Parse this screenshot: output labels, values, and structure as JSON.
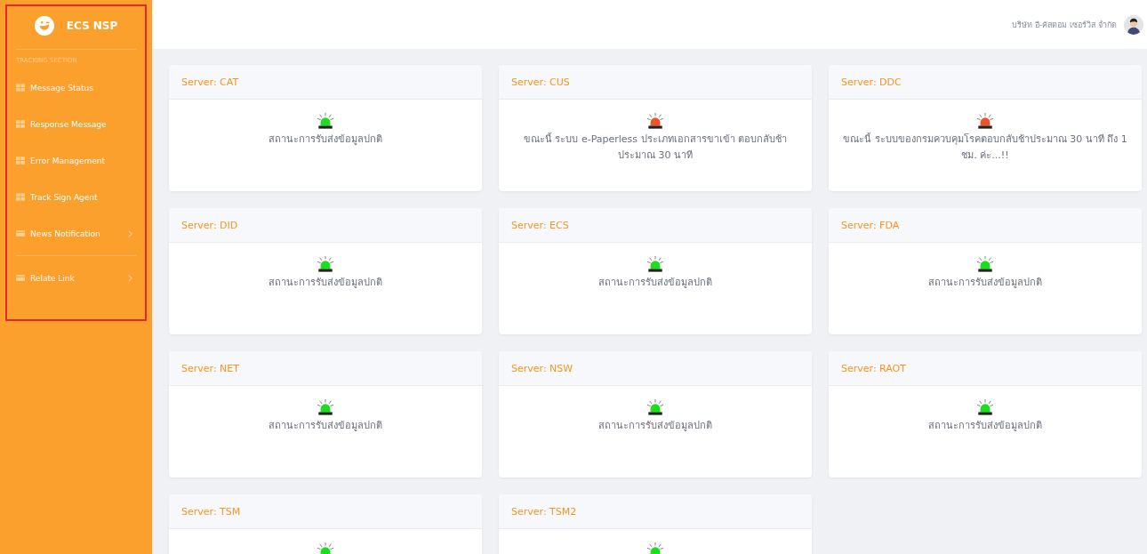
{
  "brand": {
    "name": "ECS NSP"
  },
  "sidebar": {
    "section_label": "TRACKING SECTION",
    "items": [
      {
        "label": "Message Status",
        "kind": "grid",
        "has_submenu": false
      },
      {
        "label": "Response Message",
        "kind": "grid",
        "has_submenu": false
      },
      {
        "label": "Error Management",
        "kind": "grid",
        "has_submenu": false
      },
      {
        "label": "Track Sign Agent",
        "kind": "grid",
        "has_submenu": false
      },
      {
        "label": "News Notification",
        "kind": "card",
        "has_submenu": true
      },
      {
        "label": "Relate Link",
        "kind": "card",
        "has_submenu": true,
        "divider_before": true
      }
    ]
  },
  "header": {
    "company": "บริษัท อี-คัสตอม เซอร์วิส จำกัด"
  },
  "servers": [
    {
      "title": "Server: CAT",
      "color": "#19e01a",
      "message": "สถานะการรับส่งข้อมูลปกติ"
    },
    {
      "title": "Server: CUS",
      "color": "#f0522a",
      "message": "ขณะนี้ ระบบ e-Paperless ประเภทเอกสารขาเข้า ตอบกลับช้าประมาณ 30 นาที"
    },
    {
      "title": "Server: DDC",
      "color": "#f0522a",
      "message": "ขณะนี้ ระบบของกรมควบคุมโรคตอบกลับช้าประมาณ 30 นาที ถึง 1 ชม. ค่ะ...!!"
    },
    {
      "title": "Server: DID",
      "color": "#19e01a",
      "message": "สถานะการรับส่งข้อมูลปกติ"
    },
    {
      "title": "Server: ECS",
      "color": "#19e01a",
      "message": "สถานะการรับส่งข้อมูลปกติ"
    },
    {
      "title": "Server: FDA",
      "color": "#19e01a",
      "message": "สถานะการรับส่งข้อมูลปกติ"
    },
    {
      "title": "Server: NET",
      "color": "#19e01a",
      "message": "สถานะการรับส่งข้อมูลปกติ"
    },
    {
      "title": "Server: NSW",
      "color": "#19e01a",
      "message": "สถานะการรับส่งข้อมูลปกติ"
    },
    {
      "title": "Server: RAOT",
      "color": "#19e01a",
      "message": "สถานะการรับส่งข้อมูลปกติ"
    },
    {
      "title": "Server: TSM",
      "color": "#19e01a"
    },
    {
      "title": "Server: TSM2",
      "color": "#19e01a"
    }
  ]
}
